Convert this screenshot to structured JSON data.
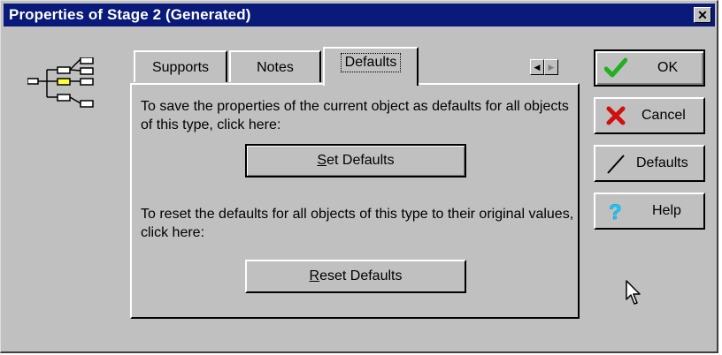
{
  "window": {
    "title": "Properties of Stage 2 (Generated)",
    "close_glyph": "✕",
    "title_bar_color": "#0a1a7a"
  },
  "tabs": [
    {
      "label": "Supports",
      "active": false
    },
    {
      "label": "Notes",
      "active": false
    },
    {
      "label": "Defaults",
      "active": true
    }
  ],
  "panel": {
    "save_text": "To save the properties of the current object as defaults for all objects of this type, click here:",
    "set_button": {
      "mnemonic": "S",
      "rest": "et Defaults"
    },
    "reset_text": "To reset the defaults for all objects of this type to their original values, click here:",
    "reset_button": {
      "mnemonic": "R",
      "rest": "eset Defaults"
    }
  },
  "side_buttons": {
    "ok": {
      "label": "OK",
      "icon": "check-icon"
    },
    "cancel": {
      "label": "Cancel",
      "icon": "x-icon"
    },
    "defaults": {
      "label": "Defaults",
      "icon": "wand-icon"
    },
    "help": {
      "label": "Help",
      "icon": "question-icon"
    }
  },
  "icons": {
    "tree": "tree-diagram-icon",
    "tab_scroll_left": "◀",
    "tab_scroll_right": "▶"
  }
}
